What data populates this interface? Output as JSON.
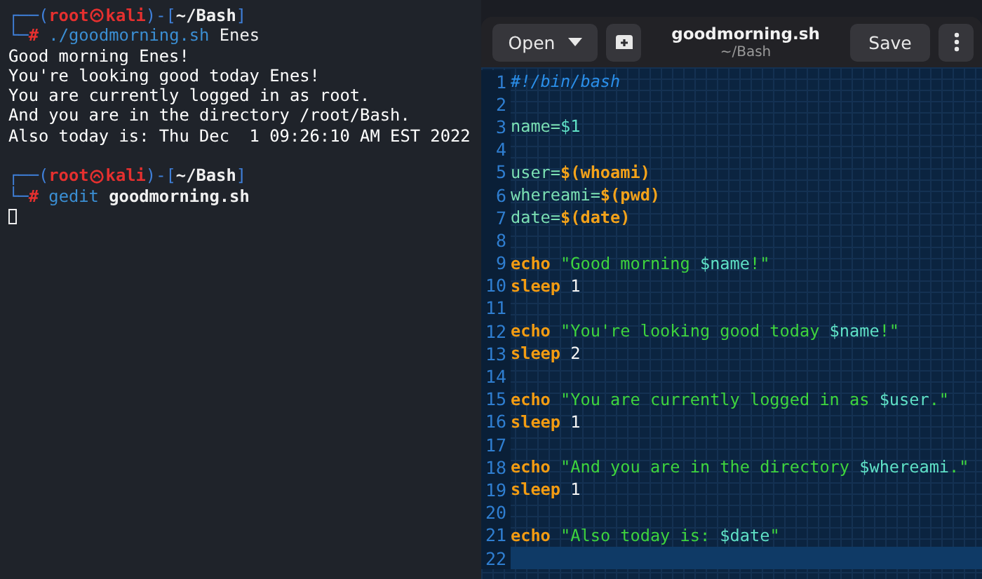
{
  "terminal": {
    "blocks": [
      {
        "kind": "prompt",
        "open": "┌──(",
        "user": "root",
        "host": "kali",
        "mid": ")-[",
        "path": "~/Bash",
        "close": "]",
        "corner": "└─",
        "hash": "#",
        "command": "./goodmorning.sh",
        "args": "Enes",
        "args_bold": false
      },
      {
        "kind": "output",
        "text": "Good morning Enes!"
      },
      {
        "kind": "output",
        "text": "You're looking good today Enes!"
      },
      {
        "kind": "output",
        "text": "You are currently logged in as root."
      },
      {
        "kind": "output",
        "text": "And you are in the directory /root/Bash."
      },
      {
        "kind": "output",
        "text": "Also today is: Thu Dec  1 09:26:10 AM EST 2022"
      },
      {
        "kind": "blank"
      },
      {
        "kind": "prompt",
        "open": "┌──(",
        "user": "root",
        "host": "kali",
        "mid": ")-[",
        "path": "~/Bash",
        "close": "]",
        "corner": "└─",
        "hash": "#",
        "command": "gedit",
        "args": "goodmorning.sh",
        "args_bold": true
      },
      {
        "kind": "cursor"
      }
    ]
  },
  "editor": {
    "open_button": "Open",
    "title": "goodmorning.sh",
    "subtitle": "~/Bash",
    "save_button": "Save",
    "lines": [
      {
        "number": "1",
        "current": false,
        "tokens": [
          {
            "kind": "comment",
            "text": "#!/bin/bash"
          }
        ]
      },
      {
        "number": "2",
        "current": false
      },
      {
        "number": "3",
        "current": false,
        "tokens": [
          {
            "kind": "ident",
            "text": "name="
          },
          {
            "kind": "var",
            "text": "$1"
          }
        ]
      },
      {
        "number": "4",
        "current": false
      },
      {
        "number": "5",
        "current": false,
        "tokens": [
          {
            "kind": "ident",
            "text": "user="
          },
          {
            "kind": "subst",
            "text": "$(whoami)"
          }
        ]
      },
      {
        "number": "6",
        "current": false,
        "tokens": [
          {
            "kind": "ident",
            "text": "whereami="
          },
          {
            "kind": "subst",
            "text": "$(pwd)"
          }
        ]
      },
      {
        "number": "7",
        "current": false,
        "tokens": [
          {
            "kind": "ident",
            "text": "date="
          },
          {
            "kind": "subst",
            "text": "$(date)"
          }
        ]
      },
      {
        "number": "8",
        "current": false
      },
      {
        "number": "9",
        "current": false,
        "tokens": [
          {
            "kind": "keyword",
            "text": "echo"
          },
          {
            "kind": "string",
            "text": "\"Good morning "
          },
          {
            "kind": "var",
            "text": "$name"
          },
          {
            "kind": "string",
            "text": "!\""
          }
        ]
      },
      {
        "number": "10",
        "current": false,
        "tokens": [
          {
            "kind": "keyword",
            "text": "sleep"
          },
          {
            "kind": "number",
            "text": "1"
          }
        ]
      },
      {
        "number": "11",
        "current": false
      },
      {
        "number": "12",
        "current": false,
        "tokens": [
          {
            "kind": "keyword",
            "text": "echo"
          },
          {
            "kind": "string",
            "text": "\"You're looking good today "
          },
          {
            "kind": "var",
            "text": "$name"
          },
          {
            "kind": "string",
            "text": "!\""
          }
        ]
      },
      {
        "number": "13",
        "current": false,
        "tokens": [
          {
            "kind": "keyword",
            "text": "sleep"
          },
          {
            "kind": "number",
            "text": "2"
          }
        ]
      },
      {
        "number": "14",
        "current": false
      },
      {
        "number": "15",
        "current": false,
        "tokens": [
          {
            "kind": "keyword",
            "text": "echo"
          },
          {
            "kind": "string",
            "text": "\"You are currently logged in as "
          },
          {
            "kind": "var",
            "text": "$user"
          },
          {
            "kind": "string",
            "text": ".\""
          }
        ]
      },
      {
        "number": "16",
        "current": false,
        "tokens": [
          {
            "kind": "keyword",
            "text": "sleep"
          },
          {
            "kind": "number",
            "text": "1"
          }
        ]
      },
      {
        "number": "17",
        "current": false
      },
      {
        "number": "18",
        "current": false,
        "tokens": [
          {
            "kind": "keyword",
            "text": "echo"
          },
          {
            "kind": "string",
            "text": "\"And you are in the directory "
          },
          {
            "kind": "var",
            "text": "$whereami"
          },
          {
            "kind": "string",
            "text": ".\""
          }
        ]
      },
      {
        "number": "19",
        "current": false,
        "tokens": [
          {
            "kind": "keyword",
            "text": "sleep"
          },
          {
            "kind": "number",
            "text": "1"
          }
        ]
      },
      {
        "number": "20",
        "current": false
      },
      {
        "number": "21",
        "current": false,
        "tokens": [
          {
            "kind": "keyword",
            "text": "echo"
          },
          {
            "kind": "string",
            "text": "\"Also today is: "
          },
          {
            "kind": "var",
            "text": "$date"
          },
          {
            "kind": "string",
            "text": "\""
          }
        ]
      },
      {
        "number": "22",
        "current": true
      }
    ]
  }
}
